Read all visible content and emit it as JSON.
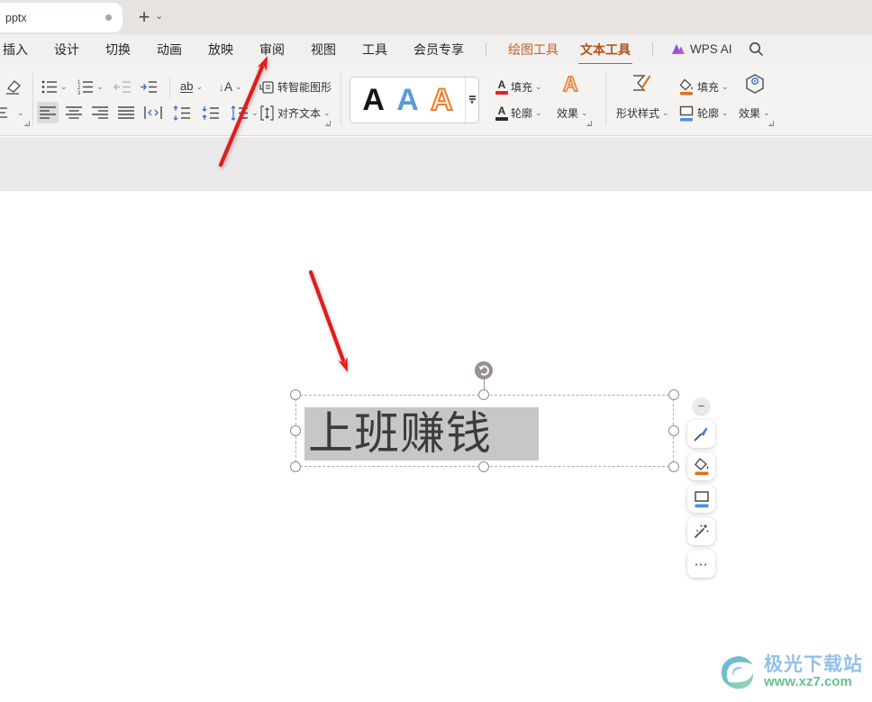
{
  "titlebar": {
    "tab_title": "pptx"
  },
  "menubar": {
    "items": [
      "插入",
      "设计",
      "切换",
      "动画",
      "放映",
      "审阅",
      "视图",
      "工具",
      "会员专享"
    ],
    "drawing_tools": "绘图工具",
    "text_tools": "文本工具",
    "wps_ai_label": "WPS AI"
  },
  "ribbon": {
    "char_spacing_label": "ab",
    "convert_smartart_label": "转智能图形",
    "align_text_label": "对齐文本",
    "wordart_letters": [
      "A",
      "A",
      "A"
    ],
    "text_fill_label": "填充",
    "text_outline_label": "轮廓",
    "text_effects_label": "效果",
    "shape_styles_label": "形状样式",
    "shape_fill_label": "填充",
    "shape_outline_label": "轮廓",
    "shape_effects_label": "效果"
  },
  "slide": {
    "textbox_text": "上班赚钱"
  },
  "watermark": {
    "site_name": "极光下载站",
    "site_url": "www.xz7.com"
  },
  "icons": {
    "plus": "+",
    "chevron_down": "⌄",
    "caret_down": "▾",
    "minus": "−",
    "ellipsis": "⋯",
    "letter_a": "A",
    "arrow_down": "↓"
  },
  "colors": {
    "accent_orange": "#c05a1e",
    "arrow_red": "#e01d1d",
    "wordart_blue": "#5b9bd5",
    "wordart_orange": "#ed7d31",
    "fill_red": "#e02222",
    "outline_black": "#2b2b2b",
    "bucket_orange": "#d9731a",
    "outline_blue": "#4a90d9",
    "selection_gray": "#c7c7c7"
  }
}
